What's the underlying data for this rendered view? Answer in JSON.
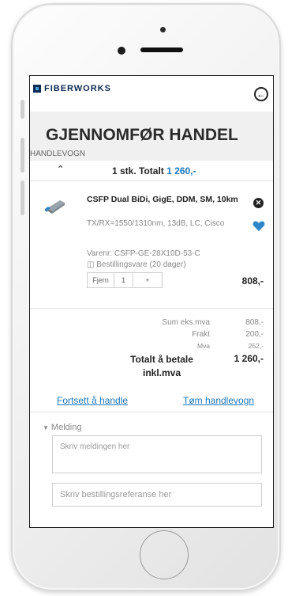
{
  "brand": {
    "name": "FIBERWORKS"
  },
  "page": {
    "title": "GJENNOMFØR HANDEL",
    "subtitle": "HANDLEVOGN"
  },
  "cart": {
    "summary_prefix": "1 stk. Totalt",
    "summary_amount": "1 260,-",
    "items": [
      {
        "name": "CSFP Dual BiDi, GigE, DDM, SM, 10km",
        "spec": "TX/RX=1550/1310nm, 13dB, LC, Cisco",
        "sku": "Varenr: CSFP-GE-28X10D-53-C",
        "stock": "Bestillingsvare (20 dager)",
        "remove_label": "Fjern",
        "quantity": "1",
        "plus_label": "+",
        "price": "808,-"
      }
    ]
  },
  "totals": {
    "sum_label": "Sum eks.mva",
    "sum_value": "808,-",
    "freight_label": "Frakt",
    "freight_value": "200,-",
    "vat_label": "Mva",
    "vat_value": "252,-",
    "grand_label": "Totalt å betale inkl.mva",
    "grand_value": "1 260,-"
  },
  "actions": {
    "continue": "Fortsett å handle",
    "empty": "Tøm handlevogn"
  },
  "message": {
    "toggle_label": "Melding",
    "message_placeholder": "Skriv meldingen her",
    "reference_placeholder": "Skriv bestillingsreferanse her"
  },
  "colors": {
    "brand": "#0d2a52",
    "accent": "#1b75bb",
    "heart": "#2e86c8"
  },
  "icons": {
    "back": "back-arrow-icon",
    "remove": "close-icon",
    "favorite": "heart-icon",
    "collapse": "chevron-up-icon",
    "expand": "chevron-down-icon",
    "stock": "box-icon"
  }
}
